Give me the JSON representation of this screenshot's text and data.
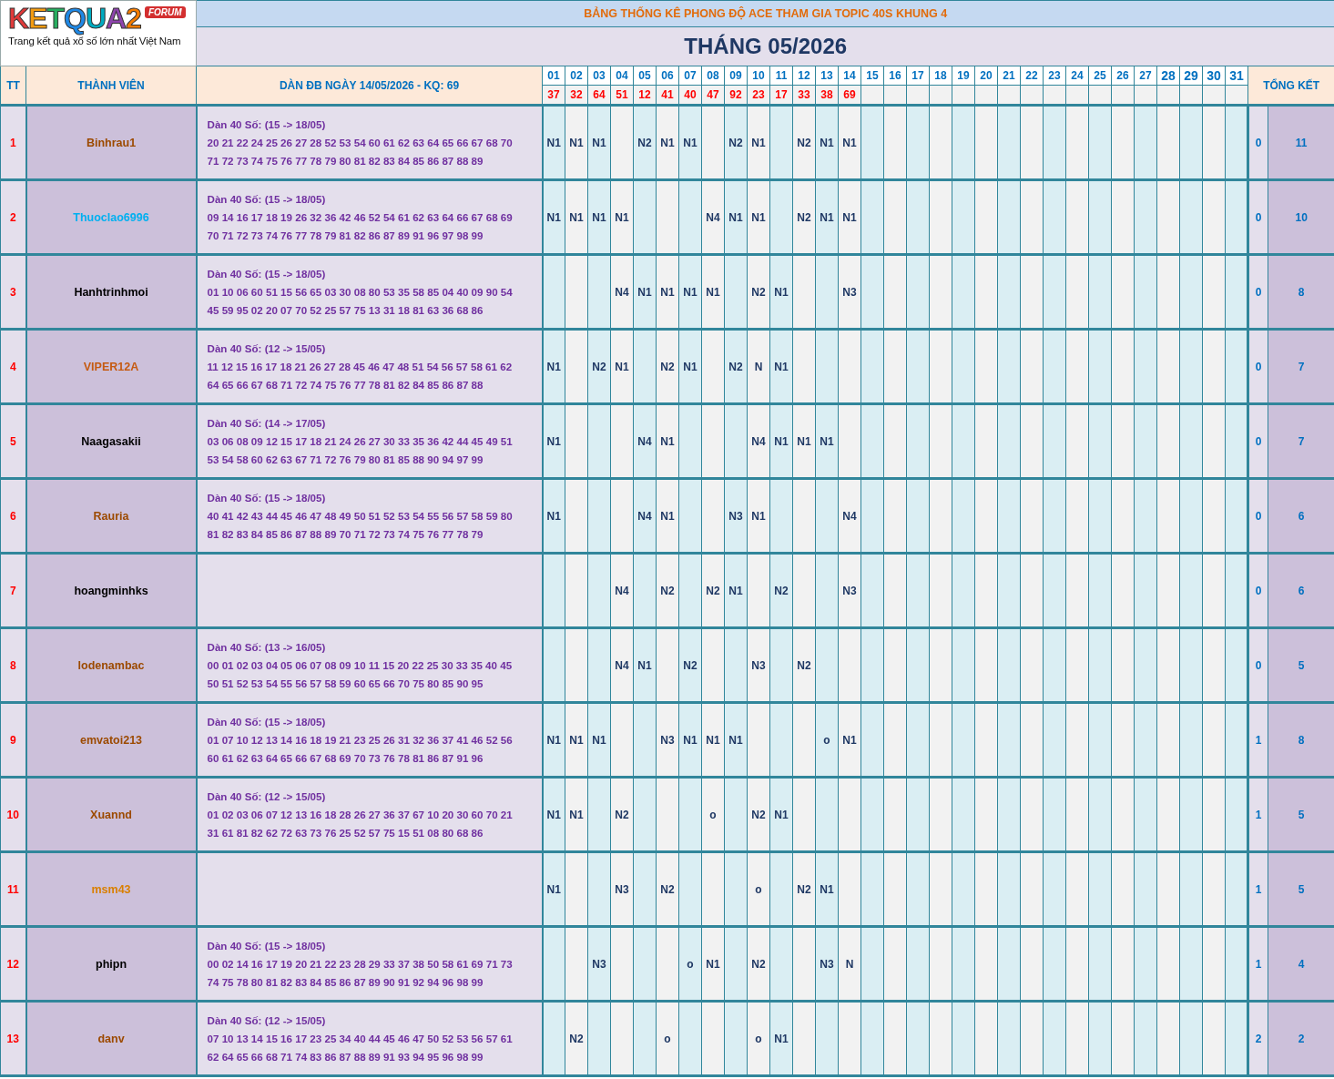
{
  "logo": {
    "wordmark": "KETQUA2",
    "badge": "FORUM",
    "tagline": "Trang kết quả xổ số lớn nhất Việt Nam"
  },
  "title": "BẢNG THỐNG KÊ PHONG ĐỘ ACE THAM GIA TOPIC 40S KHUNG 4",
  "month": "THÁNG 05/2026",
  "headers": {
    "tt": "TT",
    "member": "THÀNH VIÊN",
    "dan": "DÀN ĐB NGÀY 14/05/2026 - KQ: 69",
    "summary": "TỔNG KẾT"
  },
  "days": [
    {
      "day": "01",
      "result": "37",
      "large": false
    },
    {
      "day": "02",
      "result": "32",
      "large": false
    },
    {
      "day": "03",
      "result": "64",
      "large": false
    },
    {
      "day": "04",
      "result": "51",
      "large": false
    },
    {
      "day": "05",
      "result": "12",
      "large": false
    },
    {
      "day": "06",
      "result": "41",
      "large": false
    },
    {
      "day": "07",
      "result": "40",
      "large": false
    },
    {
      "day": "08",
      "result": "47",
      "large": false
    },
    {
      "day": "09",
      "result": "92",
      "large": false
    },
    {
      "day": "10",
      "result": "23",
      "large": false
    },
    {
      "day": "11",
      "result": "17",
      "large": false
    },
    {
      "day": "12",
      "result": "33",
      "large": false
    },
    {
      "day": "13",
      "result": "38",
      "large": false
    },
    {
      "day": "14",
      "result": "69",
      "large": false
    },
    {
      "day": "15",
      "large": false
    },
    {
      "day": "16",
      "large": false
    },
    {
      "day": "17",
      "large": false
    },
    {
      "day": "18",
      "large": false
    },
    {
      "day": "19",
      "large": false
    },
    {
      "day": "20",
      "large": false
    },
    {
      "day": "21",
      "large": false
    },
    {
      "day": "22",
      "large": false
    },
    {
      "day": "23",
      "large": false
    },
    {
      "day": "24",
      "large": false
    },
    {
      "day": "25",
      "large": false
    },
    {
      "day": "26",
      "large": false
    },
    {
      "day": "27",
      "large": false
    },
    {
      "day": "28",
      "large": true
    },
    {
      "day": "29",
      "large": true
    },
    {
      "day": "30",
      "large": true
    },
    {
      "day": "31",
      "large": true
    }
  ],
  "rows": [
    {
      "tt": "1",
      "name": "Binhrau1",
      "color": "#9c4a00",
      "dan": {
        "title": "Dàn 40 Số: (15 -> 18/05)",
        "lines": [
          "20 21 22 24 25 26 27 28 52 53 54 60 61 62 63 64 65 66 67 68 70",
          "71 72 73 74 75 76 77 78 79 80 81 82 83 84 85 86 87 88 89"
        ]
      },
      "cells": [
        "N1",
        "N1",
        "N1",
        null,
        "N2",
        "N1",
        "N1",
        null,
        "N2",
        "N1",
        null,
        "N2",
        "N1",
        "N1"
      ],
      "summary": [
        "0",
        "11"
      ]
    },
    {
      "tt": "2",
      "name": "Thuoclao6996",
      "color": "#00b0f0",
      "dan": {
        "title": "Dàn 40 Số: (15 -> 18/05)",
        "lines": [
          "09 14 16 17 18 19 26 32 36 42 46 52 54 61 62 63 64 66 67 68 69",
          "70 71 72 73 74 76 77 78 79 81 82 86 87 89 91 96 97 98 99"
        ]
      },
      "cells": [
        "N1",
        "N1",
        "N1",
        "N1",
        null,
        null,
        null,
        "N4",
        "N1",
        "N1",
        null,
        "N2",
        "N1",
        "N1"
      ],
      "summary": [
        "0",
        "10"
      ]
    },
    {
      "tt": "3",
      "name": "Hanhtrinhmoi",
      "color": "#000000",
      "dan": {
        "title": "Dàn 40 Số: (15 -> 18/05)",
        "lines": [
          "01 10 06 60 51 15 56 65 03 30 08 80 53 35 58 85 04 40 09 90 54",
          "45 59 95 02 20 07 70 52 25 57 75 13 31 18 81 63 36 68 86"
        ]
      },
      "cells": [
        null,
        null,
        null,
        "N4",
        "N1",
        "N1",
        "N1",
        "N1",
        null,
        "N2",
        "N1",
        null,
        null,
        "N3"
      ],
      "summary": [
        "0",
        "8"
      ]
    },
    {
      "tt": "4",
      "name": "VIPER12A",
      "color": "#c55a11",
      "dan": {
        "title": "Dàn 40 Số: (12 -> 15/05)",
        "lines": [
          "11 12 15 16 17 18 21 26 27 28 45 46 47 48 51 54 56 57 58 61 62",
          "64 65 66 67 68 71 72 74 75 76 77 78 81 82 84 85 86 87 88"
        ]
      },
      "cells": [
        "N1",
        null,
        "N2",
        "N1",
        null,
        "N2",
        "N1",
        null,
        "N2",
        "N",
        "N1"
      ],
      "summary": [
        "0",
        "7"
      ]
    },
    {
      "tt": "5",
      "name": "Naagasakii",
      "color": "#000000",
      "dan": {
        "title": "Dàn 40 Số: (14 -> 17/05)",
        "lines": [
          "03 06 08 09 12 15 17 18 21 24 26 27 30 33 35 36 42 44 45 49 51",
          "53 54 58 60 62 63 67 71 72 76 79 80 81 85 88 90 94 97 99"
        ]
      },
      "cells": [
        "N1",
        null,
        null,
        null,
        "N4",
        "N1",
        null,
        null,
        null,
        "N4",
        "N1",
        "N1",
        "N1"
      ],
      "summary": [
        "0",
        "7"
      ]
    },
    {
      "tt": "6",
      "name": "Rauria",
      "color": "#9c4a00",
      "dan": {
        "title": "Dàn 40 Số: (15 -> 18/05)",
        "lines": [
          "40 41 42 43 44 45 46 47 48 49 50 51 52 53 54 55 56 57 58 59 80",
          "81 82 83 84 85 86 87 88 89 70 71 72 73 74 75 76 77 78 79"
        ]
      },
      "cells": [
        "N1",
        null,
        null,
        null,
        "N4",
        "N1",
        null,
        null,
        "N3",
        "N1",
        null,
        null,
        null,
        "N4"
      ],
      "summary": [
        "0",
        "6"
      ]
    },
    {
      "tt": "7",
      "name": "hoangminhks",
      "color": "#000000",
      "cells": [
        null,
        null,
        null,
        "N4",
        null,
        "N2",
        null,
        "N2",
        "N1",
        null,
        "N2",
        null,
        null,
        "N3"
      ],
      "summary": [
        "0",
        "6"
      ]
    },
    {
      "tt": "8",
      "name": "lodenambac",
      "color": "#9c4a00",
      "dan": {
        "title": "Dàn 40 Số: (13 -> 16/05)",
        "lines": [
          "00 01 02 03 04 05 06 07 08 09 10 11 15 20 22 25 30 33 35 40 45",
          "50 51 52 53 54 55 56 57 58 59 60 65 66 70 75 80 85 90 95"
        ]
      },
      "cells": [
        null,
        null,
        null,
        "N4",
        "N1",
        null,
        "N2",
        null,
        null,
        "N3",
        null,
        "N2"
      ],
      "summary": [
        "0",
        "5"
      ]
    },
    {
      "tt": "9",
      "name": "emvatoi213",
      "color": "#9c4a00",
      "dan": {
        "title": "Dàn 40 Số: (15 -> 18/05)",
        "lines": [
          "01 07 10 12 13 14 16 18 19 21 23 25 26 31 32 36 37 41 46 52 56",
          "60 61 62 63 64 65 66 67 68 69 70 73 76 78 81 86 87 91 96"
        ]
      },
      "cells": [
        "N1",
        "N1",
        "N1",
        null,
        null,
        "N3",
        "N1",
        "N1",
        "N1",
        null,
        null,
        null,
        "o",
        "N1"
      ],
      "summary": [
        "1",
        "8"
      ]
    },
    {
      "tt": "10",
      "name": "Xuannd",
      "color": "#9c4a00",
      "dan": {
        "title": "Dàn 40 Số: (12 -> 15/05)",
        "lines": [
          "01 02 03 06 07 12 13 16 18 28 26 27 36 37 67 10 20 30 60 70 21",
          "31 61 81 82 62 72 63 73 76 25 52 57 75 15 51 08 80 68 86"
        ]
      },
      "cells": [
        "N1",
        "N1",
        null,
        "N2",
        null,
        null,
        null,
        "o",
        null,
        "N2",
        "N1"
      ],
      "summary": [
        "1",
        "5"
      ]
    },
    {
      "tt": "11",
      "name": "msm43",
      "color": "#d97f00",
      "cells": [
        "N1",
        null,
        null,
        "N3",
        null,
        "N2",
        null,
        null,
        null,
        "o",
        null,
        "N2",
        "N1"
      ],
      "summary": [
        "1",
        "5"
      ]
    },
    {
      "tt": "12",
      "name": "phipn",
      "color": "#000000",
      "dan": {
        "title": "Dàn 40 Số: (15 -> 18/05)",
        "lines": [
          "00 02 14 16 17 19 20 21 22 23 28 29 33 37 38 50 58 61 69 71 73",
          "74 75 78 80 81 82 83 84 85 86 87 89 90 91 92 94 96 98 99"
        ]
      },
      "cells": [
        null,
        null,
        "N3",
        null,
        null,
        null,
        "o",
        "N1",
        null,
        "N2",
        null,
        null,
        "N3",
        "N"
      ],
      "summary": [
        "1",
        "4"
      ]
    },
    {
      "tt": "13",
      "name": "danv",
      "color": "#9c4a00",
      "dan": {
        "title": "Dàn 40 Số: (12 -> 15/05)",
        "lines": [
          "07 10 13 14 15 16 17 23 25 34 40 44 45 46 47 50 52 53 56 57 61",
          "62 64 65 66 68 71 74 83 86 87 88 89 91 93 94 95 96 98 99"
        ]
      },
      "cells": [
        null,
        "N2",
        null,
        null,
        null,
        "o",
        null,
        null,
        null,
        "o",
        "N1"
      ],
      "summary": [
        "2",
        "2"
      ]
    }
  ]
}
